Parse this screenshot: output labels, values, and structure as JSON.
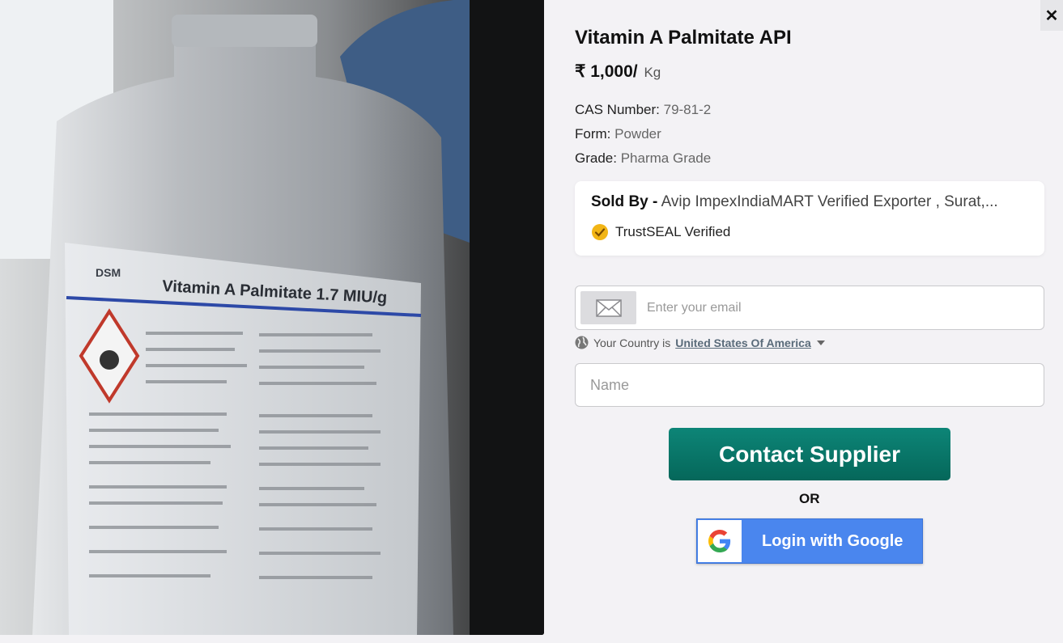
{
  "product": {
    "title": "Vitamin A Palmitate API",
    "price": "₹ 1,000/",
    "price_unit": "Kg",
    "label_text": "Vitamin A Palmitate 1.7 MIU/g",
    "label_brand": "DSM"
  },
  "specs": [
    {
      "label": "CAS Number:",
      "value": "79-81-2"
    },
    {
      "label": "Form:",
      "value": "Powder"
    },
    {
      "label": "Grade:",
      "value": "Pharma Grade"
    }
  ],
  "seller": {
    "sold_by_label": "Sold By -",
    "name": "Avip ImpexIndiaMART Verified Exporter , Surat,...",
    "trust_label": "TrustSEAL Verified"
  },
  "form": {
    "email_placeholder": "Enter your email",
    "country_prefix": "Your Country is",
    "country_value": "United States Of America",
    "name_placeholder": "Name",
    "contact_button": "Contact Supplier",
    "or_text": "OR",
    "google_button": "Login with Google"
  },
  "close_label": "✕",
  "colors": {
    "contact_button": "#077a6c",
    "google_button": "#4a86ee",
    "trust_seal": "#f2b515"
  },
  "icons": [
    "close-icon",
    "mail-icon",
    "globe-icon",
    "chevron-down-icon",
    "trust-seal-icon",
    "google-logo-icon"
  ]
}
